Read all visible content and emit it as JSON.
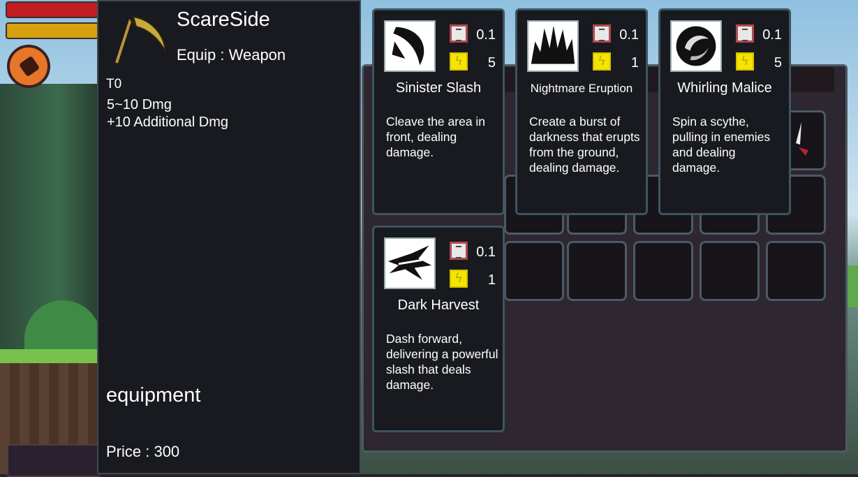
{
  "item": {
    "name": "ScareSide",
    "equip": "Equip : Weapon",
    "tier": "T0",
    "damage": "5~10 Dmg",
    "additional": "+10 Additional Dmg",
    "category": "equipment",
    "price": "Price : 300",
    "icon": "scythe-icon"
  },
  "skills": [
    {
      "name": "Sinister Slash",
      "cooldown": "0.1",
      "mana": "5",
      "description": "Cleave the area in front, dealing damage.",
      "icon": "crescent-slash-icon"
    },
    {
      "name": "Nightmare Eruption",
      "cooldown": "0.1",
      "mana": "1",
      "description": "Create a burst of darkness that erupts from the ground, dealing damage.",
      "icon": "dark-burst-icon"
    },
    {
      "name": "Whirling Malice",
      "cooldown": "0.1",
      "mana": "5",
      "description": "Spin a scythe, pulling in enemies and dealing damage.",
      "icon": "whirl-icon"
    },
    {
      "name": "Dark Harvest",
      "cooldown": "0.1",
      "mana": "1",
      "description": "Dash forward, delivering a powerful slash that deals damage.",
      "icon": "dash-slash-icon"
    }
  ],
  "hud": {
    "hp_color": "#c21d22",
    "mp_color": "#d6a10d",
    "orb_color": "#e8762a"
  },
  "colors": {
    "panel_bg": "#181a1f",
    "panel_border": "#3d5560",
    "mana": "#f4e400"
  }
}
